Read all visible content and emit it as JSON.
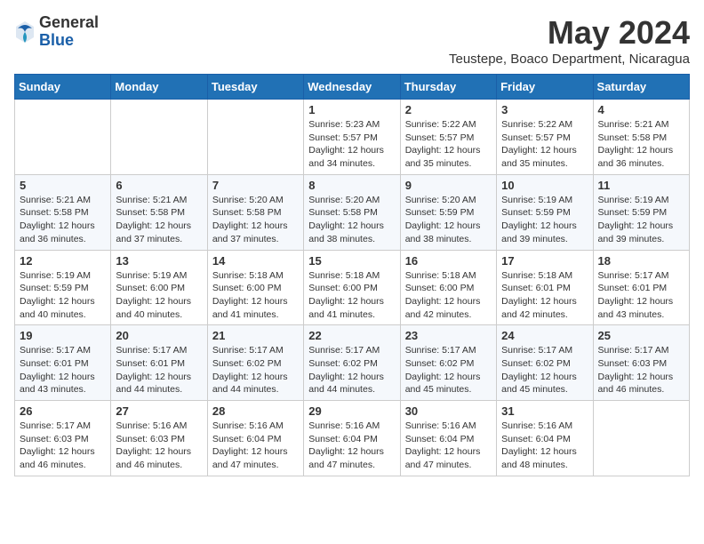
{
  "header": {
    "logo_general": "General",
    "logo_blue": "Blue",
    "month_year": "May 2024",
    "location": "Teustepe, Boaco Department, Nicaragua"
  },
  "weekdays": [
    "Sunday",
    "Monday",
    "Tuesday",
    "Wednesday",
    "Thursday",
    "Friday",
    "Saturday"
  ],
  "weeks": [
    [
      {
        "day": "",
        "text": ""
      },
      {
        "day": "",
        "text": ""
      },
      {
        "day": "",
        "text": ""
      },
      {
        "day": "1",
        "text": "Sunrise: 5:23 AM\nSunset: 5:57 PM\nDaylight: 12 hours\nand 34 minutes."
      },
      {
        "day": "2",
        "text": "Sunrise: 5:22 AM\nSunset: 5:57 PM\nDaylight: 12 hours\nand 35 minutes."
      },
      {
        "day": "3",
        "text": "Sunrise: 5:22 AM\nSunset: 5:57 PM\nDaylight: 12 hours\nand 35 minutes."
      },
      {
        "day": "4",
        "text": "Sunrise: 5:21 AM\nSunset: 5:58 PM\nDaylight: 12 hours\nand 36 minutes."
      }
    ],
    [
      {
        "day": "5",
        "text": "Sunrise: 5:21 AM\nSunset: 5:58 PM\nDaylight: 12 hours\nand 36 minutes."
      },
      {
        "day": "6",
        "text": "Sunrise: 5:21 AM\nSunset: 5:58 PM\nDaylight: 12 hours\nand 37 minutes."
      },
      {
        "day": "7",
        "text": "Sunrise: 5:20 AM\nSunset: 5:58 PM\nDaylight: 12 hours\nand 37 minutes."
      },
      {
        "day": "8",
        "text": "Sunrise: 5:20 AM\nSunset: 5:58 PM\nDaylight: 12 hours\nand 38 minutes."
      },
      {
        "day": "9",
        "text": "Sunrise: 5:20 AM\nSunset: 5:59 PM\nDaylight: 12 hours\nand 38 minutes."
      },
      {
        "day": "10",
        "text": "Sunrise: 5:19 AM\nSunset: 5:59 PM\nDaylight: 12 hours\nand 39 minutes."
      },
      {
        "day": "11",
        "text": "Sunrise: 5:19 AM\nSunset: 5:59 PM\nDaylight: 12 hours\nand 39 minutes."
      }
    ],
    [
      {
        "day": "12",
        "text": "Sunrise: 5:19 AM\nSunset: 5:59 PM\nDaylight: 12 hours\nand 40 minutes."
      },
      {
        "day": "13",
        "text": "Sunrise: 5:19 AM\nSunset: 6:00 PM\nDaylight: 12 hours\nand 40 minutes."
      },
      {
        "day": "14",
        "text": "Sunrise: 5:18 AM\nSunset: 6:00 PM\nDaylight: 12 hours\nand 41 minutes."
      },
      {
        "day": "15",
        "text": "Sunrise: 5:18 AM\nSunset: 6:00 PM\nDaylight: 12 hours\nand 41 minutes."
      },
      {
        "day": "16",
        "text": "Sunrise: 5:18 AM\nSunset: 6:00 PM\nDaylight: 12 hours\nand 42 minutes."
      },
      {
        "day": "17",
        "text": "Sunrise: 5:18 AM\nSunset: 6:01 PM\nDaylight: 12 hours\nand 42 minutes."
      },
      {
        "day": "18",
        "text": "Sunrise: 5:17 AM\nSunset: 6:01 PM\nDaylight: 12 hours\nand 43 minutes."
      }
    ],
    [
      {
        "day": "19",
        "text": "Sunrise: 5:17 AM\nSunset: 6:01 PM\nDaylight: 12 hours\nand 43 minutes."
      },
      {
        "day": "20",
        "text": "Sunrise: 5:17 AM\nSunset: 6:01 PM\nDaylight: 12 hours\nand 44 minutes."
      },
      {
        "day": "21",
        "text": "Sunrise: 5:17 AM\nSunset: 6:02 PM\nDaylight: 12 hours\nand 44 minutes."
      },
      {
        "day": "22",
        "text": "Sunrise: 5:17 AM\nSunset: 6:02 PM\nDaylight: 12 hours\nand 44 minutes."
      },
      {
        "day": "23",
        "text": "Sunrise: 5:17 AM\nSunset: 6:02 PM\nDaylight: 12 hours\nand 45 minutes."
      },
      {
        "day": "24",
        "text": "Sunrise: 5:17 AM\nSunset: 6:02 PM\nDaylight: 12 hours\nand 45 minutes."
      },
      {
        "day": "25",
        "text": "Sunrise: 5:17 AM\nSunset: 6:03 PM\nDaylight: 12 hours\nand 46 minutes."
      }
    ],
    [
      {
        "day": "26",
        "text": "Sunrise: 5:17 AM\nSunset: 6:03 PM\nDaylight: 12 hours\nand 46 minutes."
      },
      {
        "day": "27",
        "text": "Sunrise: 5:16 AM\nSunset: 6:03 PM\nDaylight: 12 hours\nand 46 minutes."
      },
      {
        "day": "28",
        "text": "Sunrise: 5:16 AM\nSunset: 6:04 PM\nDaylight: 12 hours\nand 47 minutes."
      },
      {
        "day": "29",
        "text": "Sunrise: 5:16 AM\nSunset: 6:04 PM\nDaylight: 12 hours\nand 47 minutes."
      },
      {
        "day": "30",
        "text": "Sunrise: 5:16 AM\nSunset: 6:04 PM\nDaylight: 12 hours\nand 47 minutes."
      },
      {
        "day": "31",
        "text": "Sunrise: 5:16 AM\nSunset: 6:04 PM\nDaylight: 12 hours\nand 48 minutes."
      },
      {
        "day": "",
        "text": ""
      }
    ]
  ]
}
